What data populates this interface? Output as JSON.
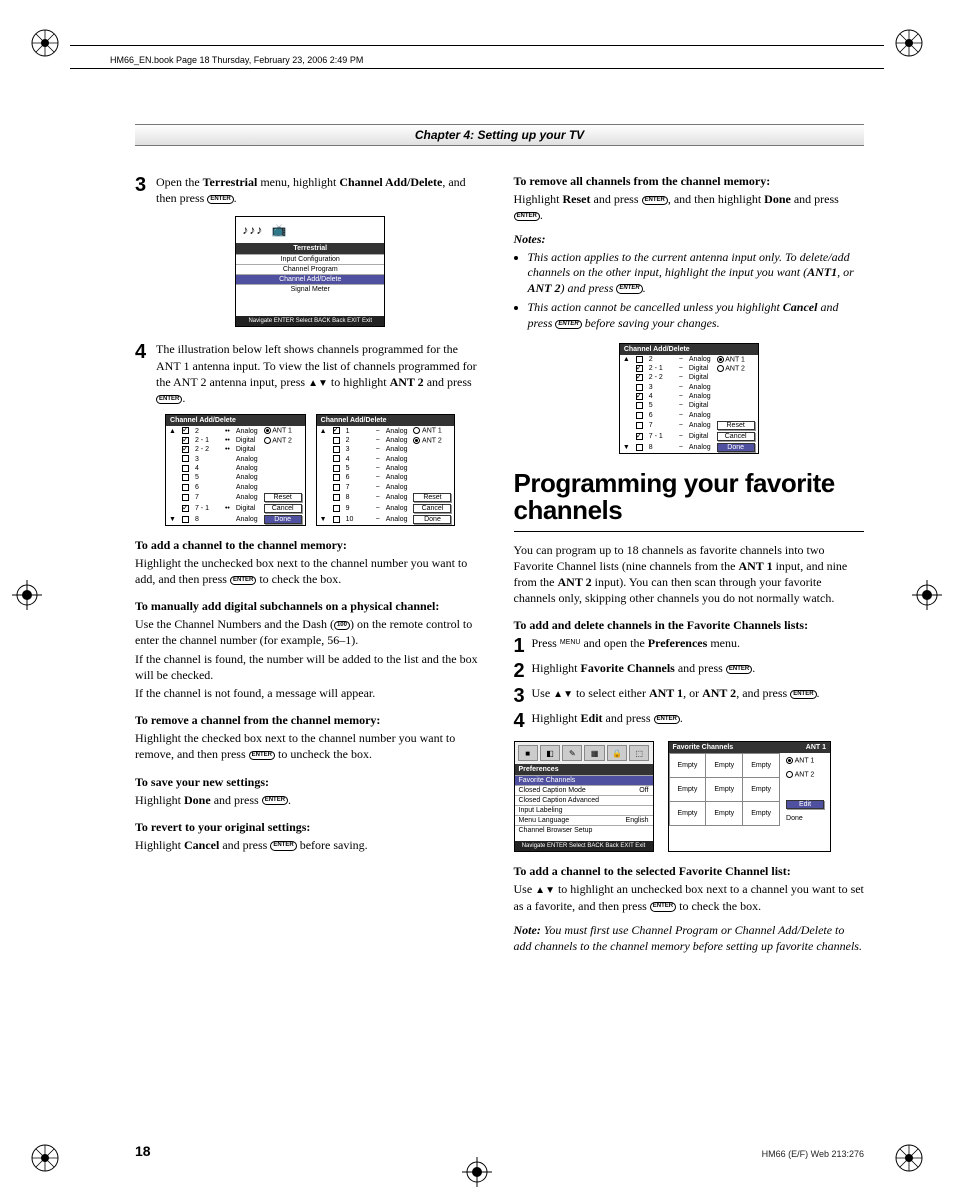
{
  "header_line": "HM66_EN.book  Page 18  Thursday, February 23, 2006  2:49 PM",
  "chapter": "Chapter 4: Setting up your TV",
  "enter_label": "ENTER",
  "left": {
    "step3_a": "Open the ",
    "step3_b": "Terrestrial",
    "step3_c": " menu, highlight ",
    "step3_d": "Channel Add/Delete",
    "step3_e": ", and then press ",
    "step3_f": ".",
    "osd1": {
      "title": "Terrestrial",
      "items": [
        "Input Configuration",
        "Channel Program",
        "Channel Add/Delete",
        "Signal Meter"
      ],
      "footer": "Navigate   ENTER Select   BACK Back   EXIT Exit"
    },
    "step4_a": "The illustration below left shows channels programmed for the ANT 1 antenna input. To view the list of channels programmed for the ANT 2 antenna input, press ",
    "step4_arrows": "▲▼",
    "step4_b": " to highlight ",
    "step4_c": "ANT 2",
    "step4_d": " and press ",
    "step4_e": ".",
    "tables_title": "Channel Add/Delete",
    "left_table": {
      "rows": [
        {
          "chk": true,
          "ch": "2",
          "dots": "••",
          "type": "Analog",
          "ant": "ANT 1",
          "sel": true
        },
        {
          "chk": true,
          "ch": "2 - 1",
          "dots": "••",
          "type": "Digital",
          "ant": "ANT 2",
          "sel": false
        },
        {
          "chk": true,
          "ch": "2 - 2",
          "dots": "••",
          "type": "Digital"
        },
        {
          "chk": false,
          "ch": "3",
          "dots": "",
          "type": "Analog"
        },
        {
          "chk": false,
          "ch": "4",
          "dots": "",
          "type": "Analog"
        },
        {
          "chk": false,
          "ch": "5",
          "dots": "",
          "type": "Analog"
        },
        {
          "chk": false,
          "ch": "6",
          "dots": "",
          "type": "Analog"
        },
        {
          "chk": false,
          "ch": "7",
          "dots": "",
          "type": "Analog",
          "btn": "Reset"
        },
        {
          "chk": true,
          "ch": "7 - 1",
          "dots": "••",
          "type": "Digital",
          "btn": "Cancel"
        },
        {
          "chk": false,
          "ch": "8",
          "dots": "",
          "type": "Analog",
          "btn": "Done",
          "btnsel": true
        }
      ]
    },
    "right_table": {
      "rows": [
        {
          "chk": true,
          "ch": "1",
          "dash": "−",
          "type": "Analog",
          "ant": "ANT 1",
          "sel": false
        },
        {
          "chk": false,
          "ch": "2",
          "dash": "−",
          "type": "Analog",
          "ant": "ANT 2",
          "sel": true
        },
        {
          "chk": false,
          "ch": "3",
          "dash": "−",
          "type": "Analog"
        },
        {
          "chk": false,
          "ch": "4",
          "dash": "−",
          "type": "Analog"
        },
        {
          "chk": false,
          "ch": "5",
          "dash": "−",
          "type": "Analog"
        },
        {
          "chk": false,
          "ch": "6",
          "dash": "−",
          "type": "Analog"
        },
        {
          "chk": false,
          "ch": "7",
          "dash": "−",
          "type": "Analog"
        },
        {
          "chk": false,
          "ch": "8",
          "dash": "−",
          "type": "Analog",
          "btn": "Reset"
        },
        {
          "chk": false,
          "ch": "9",
          "dash": "−",
          "type": "Analog",
          "btn": "Cancel"
        },
        {
          "chk": false,
          "ch": "10",
          "dash": "−",
          "type": "Analog",
          "btn": "Done"
        }
      ]
    },
    "h_add": "To add a channel to the channel memory:",
    "p_add": "Highlight the unchecked box next to the channel number you want to add, and then press ",
    "p_add2": " to check the box.",
    "h_sub": "To manually add digital subchannels on a physical channel:",
    "p_sub1": "Use the Channel Numbers and the Dash (",
    "p_sub_btn": "100",
    "p_sub1b": ") on the remote control to enter the channel number (for example, 56–1).",
    "p_sub2": "If the channel is found, the number will be added to the list and the box will be checked.",
    "p_sub3": "If the channel is not found, a message will appear.",
    "h_rem": "To remove a channel from the channel memory:",
    "p_rem": "Highlight the checked box next to the channel number you want to remove, and then press ",
    "p_rem2": " to uncheck the box.",
    "h_save": "To save your new settings:",
    "p_save1": "Highlight ",
    "p_save2": "Done",
    "p_save3": " and press ",
    "p_save4": ".",
    "h_rev": "To revert to your original settings:",
    "p_rev1": "Highlight ",
    "p_rev2": "Cancel",
    "p_rev3": " and press ",
    "p_rev4": " before saving."
  },
  "right": {
    "h_remall": "To remove all channels from the channel memory:",
    "p_remall1": "Highlight ",
    "p_remall2": "Reset",
    "p_remall3": " and press ",
    "p_remall4": ", and then highlight ",
    "p_remall5": "Done",
    "p_remall6": " and press ",
    "p_remall7": ".",
    "notes_label": "Notes:",
    "note1a": "This action applies to the current antenna input only. To delete/add channels on the other input, highlight the input you want (",
    "note1b": "ANT1",
    "note1c": ", or ",
    "note1d": "ANT 2",
    "note1e": ") and press ",
    "note1f": ".",
    "note2a": "This action cannot be cancelled unless you highlight ",
    "note2b": "Cancel",
    "note2c": " and press ",
    "note2d": " before saving your changes.",
    "center_table": {
      "title": "Channel Add/Delete",
      "rows": [
        {
          "chk": false,
          "ch": "2",
          "dash": "−",
          "type": "Analog",
          "ant": "ANT 1",
          "sel": true
        },
        {
          "chk": true,
          "ch": "2 - 1",
          "dash": "−",
          "type": "Digital",
          "ant": "ANT 2",
          "sel": false
        },
        {
          "chk": true,
          "ch": "2 - 2",
          "dash": "−",
          "type": "Digital"
        },
        {
          "chk": false,
          "ch": "3",
          "dash": "−",
          "type": "Analog"
        },
        {
          "chk": true,
          "ch": "4",
          "dash": "−",
          "type": "Analog"
        },
        {
          "chk": false,
          "ch": "5",
          "dash": "−",
          "type": "Digital"
        },
        {
          "chk": false,
          "ch": "6",
          "dash": "−",
          "type": "Analog"
        },
        {
          "chk": false,
          "ch": "7",
          "dash": "−",
          "type": "Analog",
          "btn": "Reset"
        },
        {
          "chk": true,
          "ch": "7 - 1",
          "dash": "−",
          "type": "Digital",
          "btn": "Cancel"
        },
        {
          "chk": false,
          "ch": "8",
          "dash": "−",
          "type": "Analog",
          "btn": "Done",
          "btnsel": true
        }
      ]
    },
    "section_title": "Programming your favorite channels",
    "intro1": "You can program up to 18 channels as favorite channels into two Favorite Channel lists (nine channels from the ",
    "intro2": "ANT 1",
    "intro3": " input, and nine from the ",
    "intro4": "ANT 2",
    "intro5": " input). You can then scan through your favorite channels only, skipping other channels you do not normally watch.",
    "h_addfav": "To add and delete channels in the Favorite Channels lists:",
    "fs1a": "Press ",
    "fs1_menu": "MENU",
    "fs1b": " and open the ",
    "fs1c": "Preferences",
    "fs1d": " menu.",
    "fs2a": "Highlight ",
    "fs2b": "Favorite Channels",
    "fs2c": " and press ",
    "fs2d": ".",
    "fs3a": "Use ",
    "fs3_arrows": "▲▼",
    "fs3b": " to select either ",
    "fs3c": "ANT 1",
    "fs3d": ", or ",
    "fs3e": "ANT 2",
    "fs3f": ", and press ",
    "fs3g": ".",
    "fs4a": "Highlight ",
    "fs4b": "Edit",
    "fs4c": " and press ",
    "fs4d": ".",
    "pref_osd": {
      "title": "Preferences",
      "items": [
        {
          "l": "Favorite Channels",
          "r": "",
          "sel": true
        },
        {
          "l": "Closed Caption Mode",
          "r": "Off"
        },
        {
          "l": "Closed Caption Advanced",
          "r": ""
        },
        {
          "l": "Input Labeling",
          "r": ""
        },
        {
          "l": "Menu Language",
          "r": "English"
        },
        {
          "l": "Channel Browser Setup",
          "r": ""
        }
      ],
      "footer": "Navigate  ENTER Select  BACK Back  EXIT Exit"
    },
    "fav_osd": {
      "title": "Favorite Channels",
      "ant": "ANT 1",
      "cell": "Empty",
      "ant1": "ANT 1",
      "ant2": "ANT 2",
      "edit": "Edit",
      "done": "Done"
    },
    "h_addfavlist": "To add a channel to the selected Favorite Channel list:",
    "p_addfav1": "Use ",
    "p_addfav_arrows": "▲▼",
    "p_addfav2": " to highlight an unchecked box next to a channel you want to set as a favorite, and then press ",
    "p_addfav3": " to check the box.",
    "note_fav_label": "Note:",
    "note_fav": " You must first use Channel Program or Channel Add/Delete to add channels to the channel memory before setting up favorite channels."
  },
  "page_number": "18",
  "footer_right": "HM66 (E/F) Web 213:276"
}
